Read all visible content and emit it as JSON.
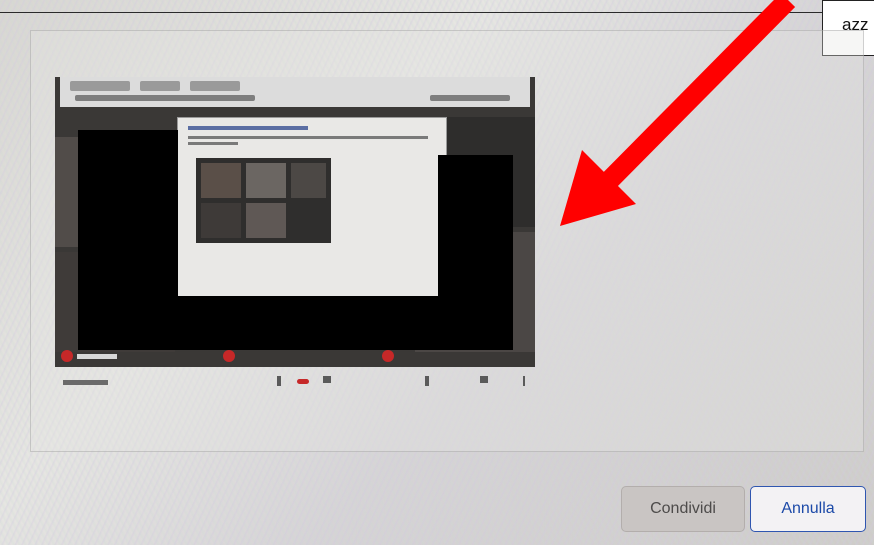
{
  "annotation": {
    "label": "azz",
    "arrow_color": "#ff0000"
  },
  "buttons": {
    "share": "Condividi",
    "cancel": "Annulla"
  },
  "colors": {
    "accent": "#1c4aa8",
    "end_call": "#c62828"
  }
}
